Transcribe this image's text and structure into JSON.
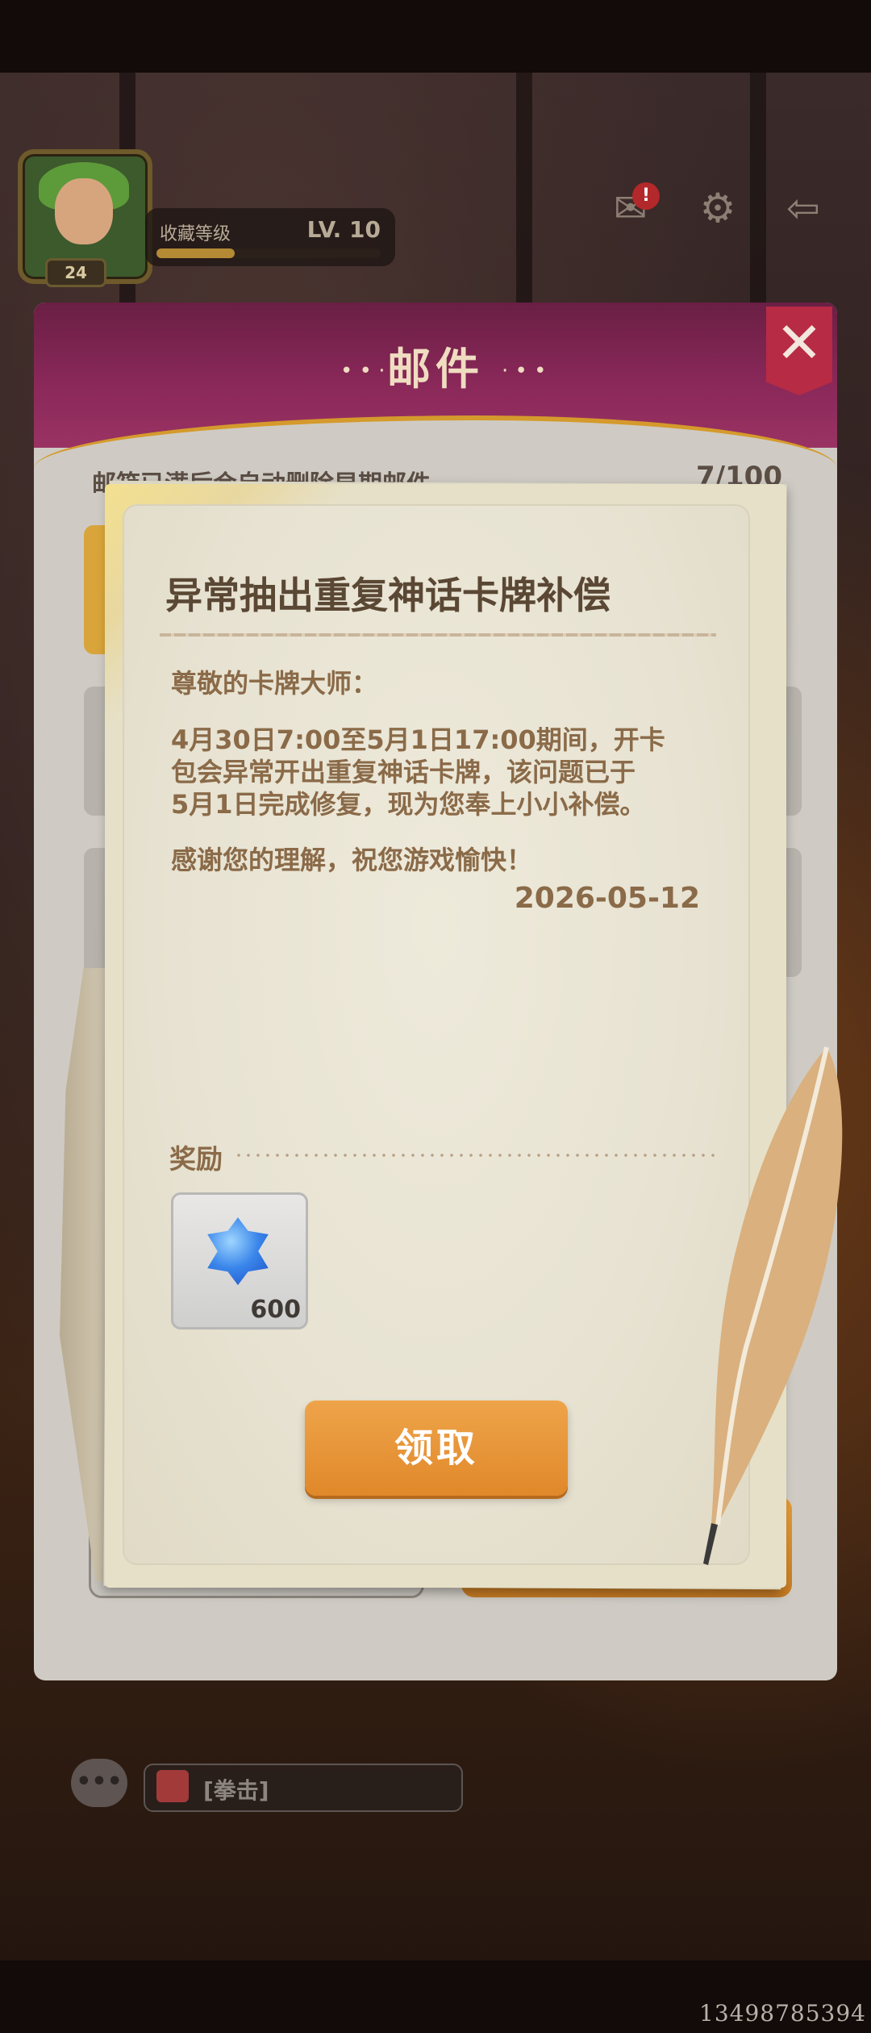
{
  "profile": {
    "level_badge": "24",
    "collection_label": "收藏等级",
    "collection_level": "LV. 10",
    "collection_progress": 0.35
  },
  "top_icons": {
    "mail": "mail-icon",
    "mail_alert": "!",
    "settings": "gear-icon",
    "exit": "exit-icon"
  },
  "mail_dialog": {
    "title": "邮件",
    "close_label": "✕",
    "hint": "邮箱已满后会自动删除早期邮件",
    "count": "7/100"
  },
  "mail": {
    "title": "异常抽出重复神话卡牌补偿",
    "greeting": "尊敬的卡牌大师：",
    "body_lines": [
      "4月30日7:00至5月1日17:00期间，开卡",
      "包会异常开出重复神话卡牌，该问题已于",
      "5月1日完成修复，现为您奉上小小补偿。"
    ],
    "thanks": "感谢您的理解，祝您游戏愉快！",
    "date": "2026-05-12",
    "reward_label": "奖励",
    "reward": {
      "icon": "blue-gem-icon",
      "quantity": "600"
    },
    "claim_button": "领取"
  },
  "chat": {
    "message": "[拳击]"
  },
  "watermark": "13498785394",
  "colors": {
    "header": "#892859",
    "accent_orange": "#e0882a",
    "text_brown": "#8a6a48",
    "close_red": "#b72b45"
  }
}
